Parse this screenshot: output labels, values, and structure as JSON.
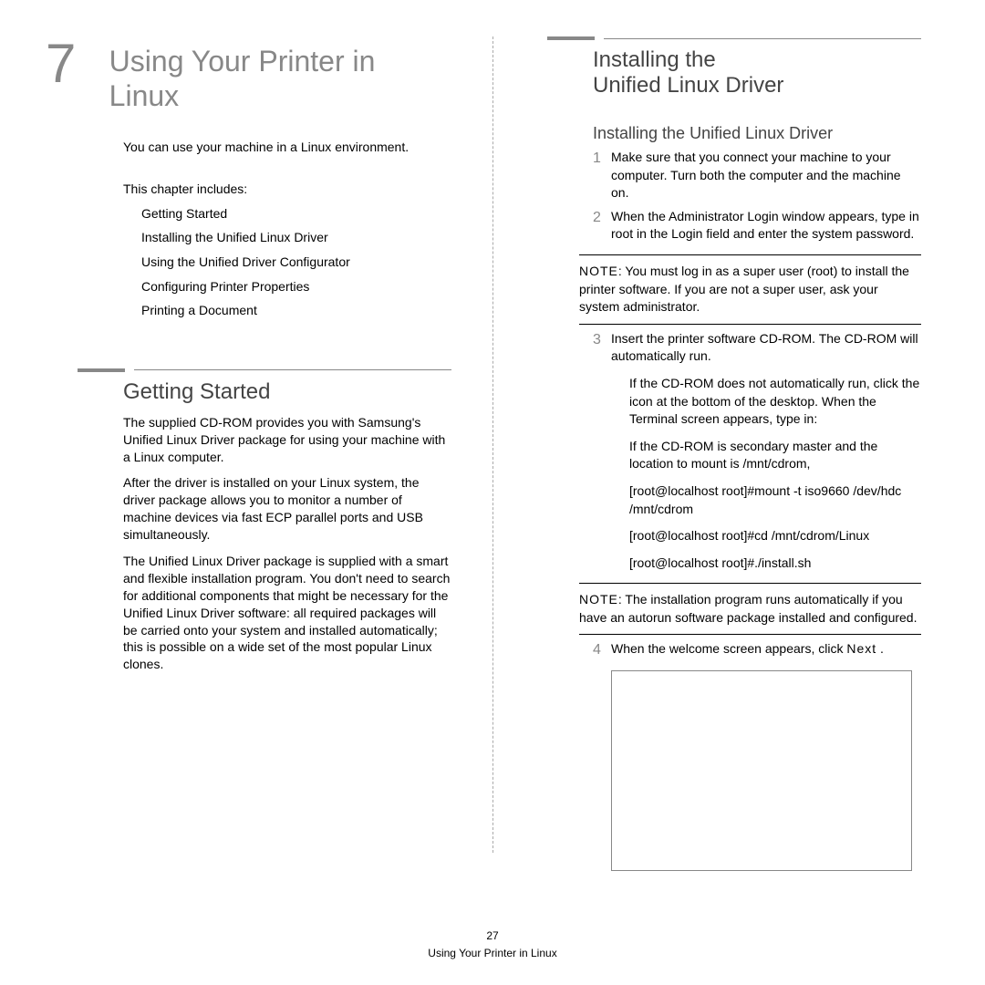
{
  "chapter": {
    "number": "7",
    "title": "Using Your Printer in Linux"
  },
  "intro": "You can use your machine in a Linux environment.",
  "toc_intro": "This chapter includes:",
  "toc": [
    "Getting Started",
    "Installing the Unified Linux Driver",
    "Using the Unified Driver Configurator",
    "Configuring Printer Properties",
    "Printing a Document"
  ],
  "section_getting_started": {
    "title": "Getting Started",
    "p1": "The supplied CD-ROM provides you with Samsung's Unified Linux Driver package for using your machine with a Linux computer.",
    "p2": "After the driver is installed on your Linux system, the driver package allows you to monitor a number of machine devices via fast ECP parallel ports and USB simultaneously.",
    "p3": "The Unified Linux Driver package is supplied with a smart and flexible installation program. You don't need to search for additional components that might be necessary for the Unified Linux Driver software: all required packages will be carried onto your system and installed automatically; this is possible on a wide set of the most popular Linux clones."
  },
  "section_install": {
    "title": "Installing the Unified Linux Driver",
    "sub_title": "Installing the Unified Linux Driver",
    "step1": "Make sure that you connect your machine to your computer. Turn both the computer and the machine on.",
    "step2_a": "When the Administrator Login window appears, type in ",
    "step2_root": "root",
    "step2_b": " in the Login field and enter the system password.",
    "note1_label": "NOTE",
    "note1": ": You must log in as a super user (root) to install the printer software. If you are not a super user, ask your system administrator.",
    "step3": "Insert the printer software CD-ROM. The CD-ROM will automatically run.",
    "step3_sub1": "If the CD-ROM does not automatically run, click the icon at the bottom of the desktop. When the Terminal screen appears, type in:",
    "step3_sub2": "If the CD-ROM is secondary master and the location to mount is /mnt/cdrom,",
    "cmd1": "[root@localhost root]#mount -t iso9660 /dev/hdc /mnt/cdrom",
    "cmd2": "[root@localhost root]#cd /mnt/cdrom/Linux",
    "cmd3": "[root@localhost root]#./install.sh",
    "note2_label": "NOTE",
    "note2": ": The installation program runs automatically if you have an autorun software package installed and configured.",
    "step4_a": "When the welcome screen appears, click ",
    "step4_b": "Next",
    "step4_c": "."
  },
  "footer": {
    "page_num": "27",
    "running": "Using Your Printer in Linux"
  }
}
